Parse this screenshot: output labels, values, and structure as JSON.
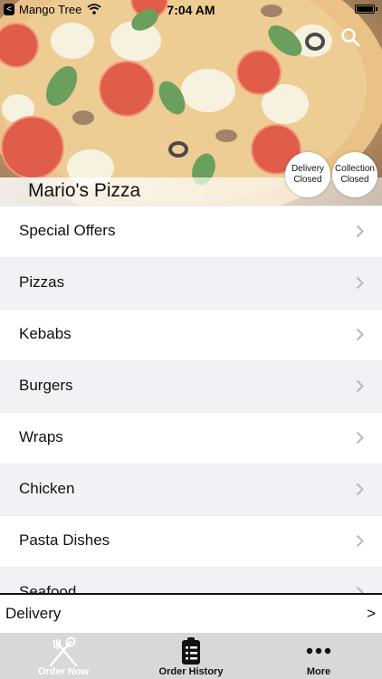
{
  "status_bar": {
    "carrier": "Mango Tree",
    "time": "7:04 AM",
    "back_glyph": "<"
  },
  "hero": {
    "restaurant_name": "Mario's Pizza",
    "delivery_status": {
      "line1": "Delivery",
      "line2": "Closed"
    },
    "collection_status": {
      "line1": "Collection",
      "line2": "Closed"
    }
  },
  "menu": {
    "items": [
      {
        "label": "Special Offers"
      },
      {
        "label": "Pizzas"
      },
      {
        "label": "Kebabs"
      },
      {
        "label": "Burgers"
      },
      {
        "label": "Wraps"
      },
      {
        "label": "Chicken"
      },
      {
        "label": "Pasta Dishes"
      },
      {
        "label": "Seafood"
      }
    ]
  },
  "delivery_bar": {
    "label": "Delivery",
    "arrow": ">"
  },
  "tabs": [
    {
      "label": "Order Now",
      "icon": "fork-knife-icon"
    },
    {
      "label": "Order History",
      "icon": "clipboard-icon"
    },
    {
      "label": "More",
      "icon": "more-dots-icon"
    }
  ],
  "colors": {
    "tab_bar": "#d8d8d8",
    "alt_row": "#f1f2f5"
  }
}
